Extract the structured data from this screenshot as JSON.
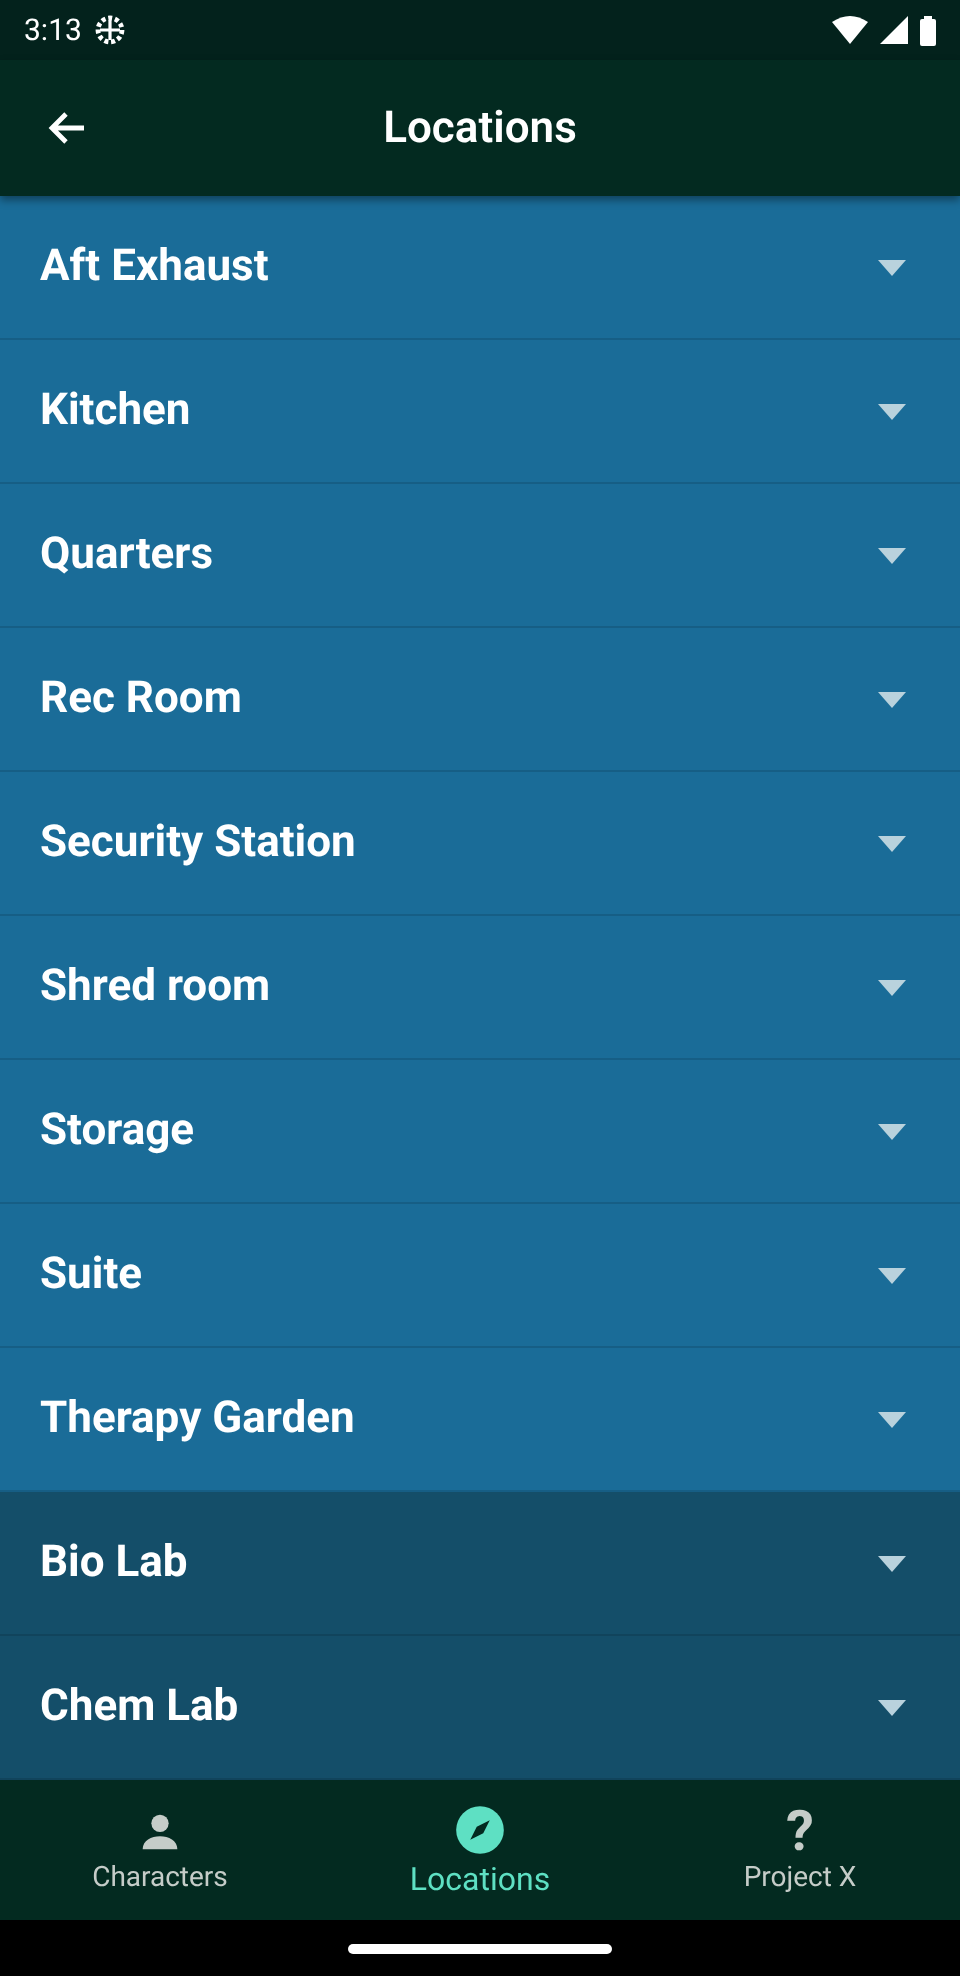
{
  "status_bar": {
    "time": "3:13"
  },
  "app_bar": {
    "title": "Locations"
  },
  "sections": [
    {
      "color": "#1a6c98",
      "items": [
        {
          "label": "Aft Exhaust",
          "expanded": false
        },
        {
          "label": "Kitchen",
          "expanded": false
        },
        {
          "label": "Quarters",
          "expanded": false
        },
        {
          "label": "Rec Room",
          "expanded": false
        },
        {
          "label": "Security Station",
          "expanded": false
        },
        {
          "label": "Shred room",
          "expanded": false
        },
        {
          "label": "Storage",
          "expanded": false
        },
        {
          "label": "Suite",
          "expanded": false
        },
        {
          "label": "Therapy Garden",
          "expanded": false
        }
      ]
    },
    {
      "color": "#144e69",
      "items": [
        {
          "label": "Bio Lab",
          "expanded": false
        },
        {
          "label": "Chem Lab",
          "expanded": false
        }
      ]
    }
  ],
  "bottom_nav": [
    {
      "kind": "person",
      "label": "Characters",
      "selected": false
    },
    {
      "kind": "compass",
      "label": "Locations",
      "selected": true
    },
    {
      "kind": "glyph",
      "icon_text": "?",
      "label": "Project X",
      "selected": false
    }
  ]
}
